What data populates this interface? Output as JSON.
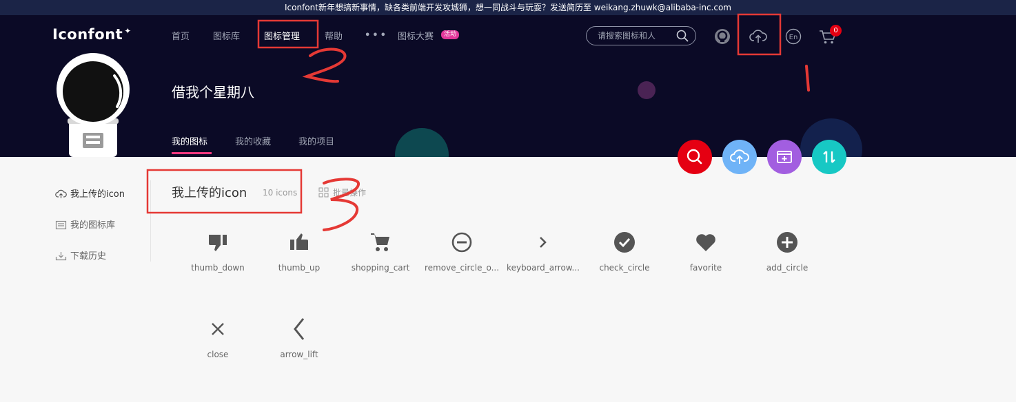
{
  "announcement": "Iconfont新年想搞新事情，缺各类前端开发攻城狮，想一同战斗与玩耍？发送简历至 weikang.zhuwk@alibaba-inc.com",
  "logo": "Iconfont",
  "nav": {
    "home": "首页",
    "library": "图标库",
    "manage": "图标管理",
    "help": "帮助",
    "more": "•••",
    "contest": "图标大赛",
    "contest_badge": "活动"
  },
  "search": {
    "placeholder": "请搜索图标和人"
  },
  "cart": {
    "count": "0"
  },
  "user": {
    "name": "借我个星期八"
  },
  "tabs": [
    "我的图标",
    "我的收藏",
    "我的项目"
  ],
  "sidebar": [
    "我上传的icon",
    "我的图标库",
    "下载历史"
  ],
  "section": {
    "title": "我上传的icon",
    "count": "10 icons",
    "batch": "批量操作"
  },
  "icons": [
    {
      "name": "thumb_down",
      "icon": "thumb-down-icon"
    },
    {
      "name": "thumb_up",
      "icon": "thumb-up-icon"
    },
    {
      "name": "shopping_cart",
      "icon": "shopping-cart-icon"
    },
    {
      "name": "remove_circle_o...",
      "icon": "remove-circle-icon"
    },
    {
      "name": "keyboard_arrow...",
      "icon": "chevron-right-icon"
    },
    {
      "name": "check_circle",
      "icon": "check-circle-icon"
    },
    {
      "name": "favorite",
      "icon": "heart-icon"
    },
    {
      "name": "add_circle",
      "icon": "add-circle-icon"
    },
    {
      "name": "close",
      "icon": "close-icon"
    },
    {
      "name": "arrow_lift",
      "icon": "arrow-left-icon"
    }
  ],
  "colors": {
    "header_bg": "#0b0a26",
    "accent_pink": "#f4387f",
    "fab_search": "#e50012",
    "fab_upload": "#6fb3f7",
    "fab_batch": "#a25ee0",
    "fab_sort": "#17c8c4",
    "annotation_red": "#e53935"
  }
}
